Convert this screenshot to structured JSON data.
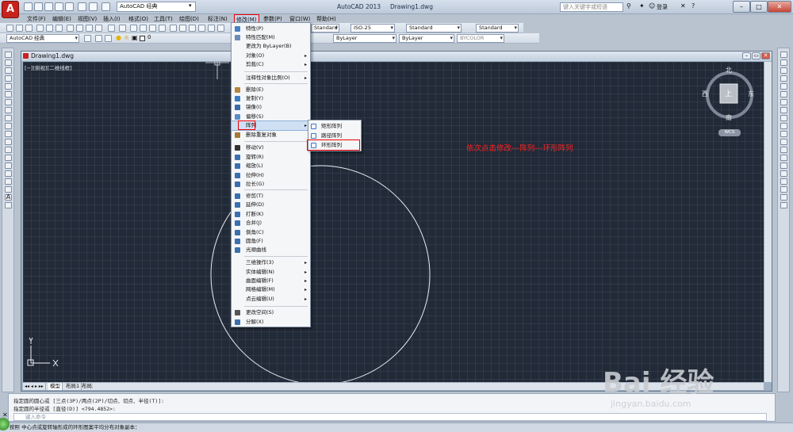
{
  "app": {
    "title": "AutoCAD 2013",
    "drawing": "Drawing1.dwg"
  },
  "titlebar": {
    "workspace": "AutoCAD 经典",
    "search_placeholder": "键入关键字或短语",
    "login": "登录"
  },
  "menubar": [
    "文件(F)",
    "编辑(E)",
    "视图(V)",
    "插入(I)",
    "格式(O)",
    "工具(T)",
    "绘图(D)",
    "标注(N)",
    "修改(M)",
    "参数(P)",
    "窗口(W)",
    "帮助(H)"
  ],
  "toolbar1": {
    "text_style": "Standard",
    "dim_style": "ISO-25",
    "table_style": "Standard",
    "mleader_style": "Standard"
  },
  "toolbar2": {
    "workspace": "AutoCAD 经典",
    "layer": "0",
    "color": "ByLayer",
    "linetype": "ByLayer",
    "lineweight": "ByLayer",
    "plotstyle": "BYCOLOR"
  },
  "document": {
    "title": "Drawing1.dwg",
    "view_label": "[−][俯视][二维线框]"
  },
  "modify_menu": [
    {
      "label": "特性(P)",
      "icon": "properties-icon",
      "arrow": false
    },
    {
      "label": "特性匹配(M)",
      "icon": "match-properties-icon",
      "arrow": false
    },
    {
      "label": "更改为 ByLayer(B)",
      "icon": "",
      "arrow": false
    },
    {
      "label": "对象(O)",
      "icon": "",
      "arrow": true
    },
    {
      "label": "剪裁(C)",
      "icon": "",
      "arrow": true
    },
    {
      "label": "注释性对象比例(O)",
      "icon": "",
      "arrow": true
    },
    {
      "label": "删除(E)",
      "icon": "erase-icon",
      "arrow": false
    },
    {
      "label": "复制(Y)",
      "icon": "copy-icon",
      "arrow": false
    },
    {
      "label": "镜像(I)",
      "icon": "mirror-icon",
      "arrow": false
    },
    {
      "label": "偏移(S)",
      "icon": "offset-icon",
      "arrow": false
    },
    {
      "label": "阵列",
      "icon": "",
      "arrow": true
    },
    {
      "label": "删除重复对象",
      "icon": "delete-duplicates-icon",
      "arrow": false
    },
    {
      "label": "移动(V)",
      "icon": "move-icon",
      "arrow": false
    },
    {
      "label": "旋转(R)",
      "icon": "rotate-icon",
      "arrow": false
    },
    {
      "label": "缩放(L)",
      "icon": "scale-icon",
      "arrow": false
    },
    {
      "label": "拉伸(H)",
      "icon": "stretch-icon",
      "arrow": false
    },
    {
      "label": "拉长(G)",
      "icon": "lengthen-icon",
      "arrow": false
    },
    {
      "label": "修剪(T)",
      "icon": "trim-icon",
      "arrow": false
    },
    {
      "label": "延伸(D)",
      "icon": "extend-icon",
      "arrow": false
    },
    {
      "label": "打断(K)",
      "icon": "break-icon",
      "arrow": false
    },
    {
      "label": "合并(J)",
      "icon": "join-icon",
      "arrow": false
    },
    {
      "label": "倒角(C)",
      "icon": "chamfer-icon",
      "arrow": false
    },
    {
      "label": "圆角(F)",
      "icon": "fillet-icon",
      "arrow": false
    },
    {
      "label": "光顺曲线",
      "icon": "blend-curves-icon",
      "arrow": false
    },
    {
      "label": "三维操作(3)",
      "icon": "",
      "arrow": true
    },
    {
      "label": "实体编辑(N)",
      "icon": "",
      "arrow": true
    },
    {
      "label": "曲面编辑(F)",
      "icon": "",
      "arrow": true
    },
    {
      "label": "网格编辑(M)",
      "icon": "",
      "arrow": true
    },
    {
      "label": "点云编辑(U)",
      "icon": "",
      "arrow": true
    },
    {
      "label": "更改空间(S)",
      "icon": "change-space-icon",
      "arrow": false
    },
    {
      "label": "分解(X)",
      "icon": "explode-icon",
      "arrow": false
    }
  ],
  "array_submenu": [
    {
      "label": "矩形阵列",
      "icon": "rectangular-array-icon"
    },
    {
      "label": "路径阵列",
      "icon": "path-array-icon"
    },
    {
      "label": "环形阵列",
      "icon": "polar-array-icon"
    }
  ],
  "annotation": "依次点击修改---阵列---环形阵列",
  "viewcube": {
    "north": "北",
    "south": "南",
    "east": "东",
    "west": "西",
    "top": "上",
    "wcs": "WCS"
  },
  "layout_tabs": [
    "模型",
    "布局1",
    "布局2"
  ],
  "command": {
    "line1": "指定圆的圆心或 [三点(3P)/两点(2P)/切点、切点、半径(T)]:",
    "line2": "指定圆的半径或 [直径(D)] <794.4852>:",
    "input_placeholder": "键入命令"
  },
  "status": "按照 中心点或旋转轴形成的环形图案平均分布对象副本：",
  "watermark": {
    "logo": "Bai 经验",
    "url": "jingyan.baidu.com"
  }
}
